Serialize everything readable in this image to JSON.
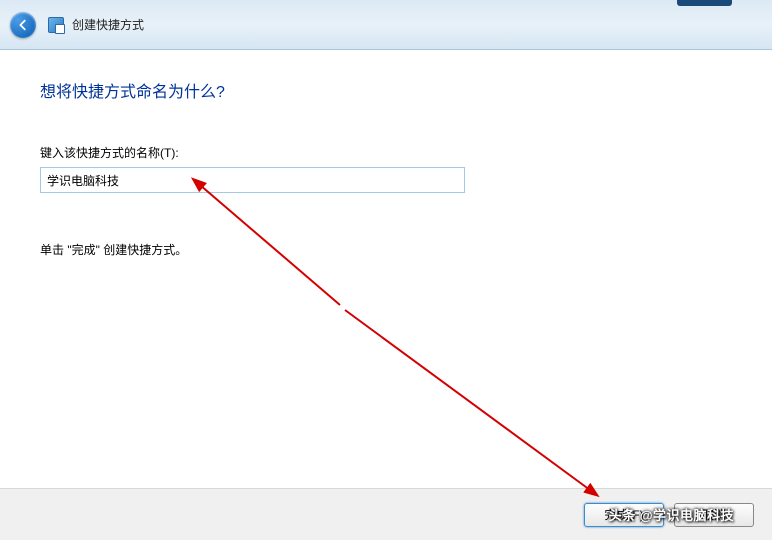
{
  "window": {
    "title": "创建快捷方式"
  },
  "heading": "想将快捷方式命名为什么?",
  "field": {
    "label": "键入该快捷方式的名称(T):",
    "value": "学识电脑科技"
  },
  "instruction": "单击 \"完成\" 创建快捷方式。",
  "footer": {
    "finish_label": "完成(F)",
    "cancel_label": "取消"
  },
  "watermark": "头条 @学识电脑科技",
  "annotation": {
    "color": "#d40000"
  }
}
